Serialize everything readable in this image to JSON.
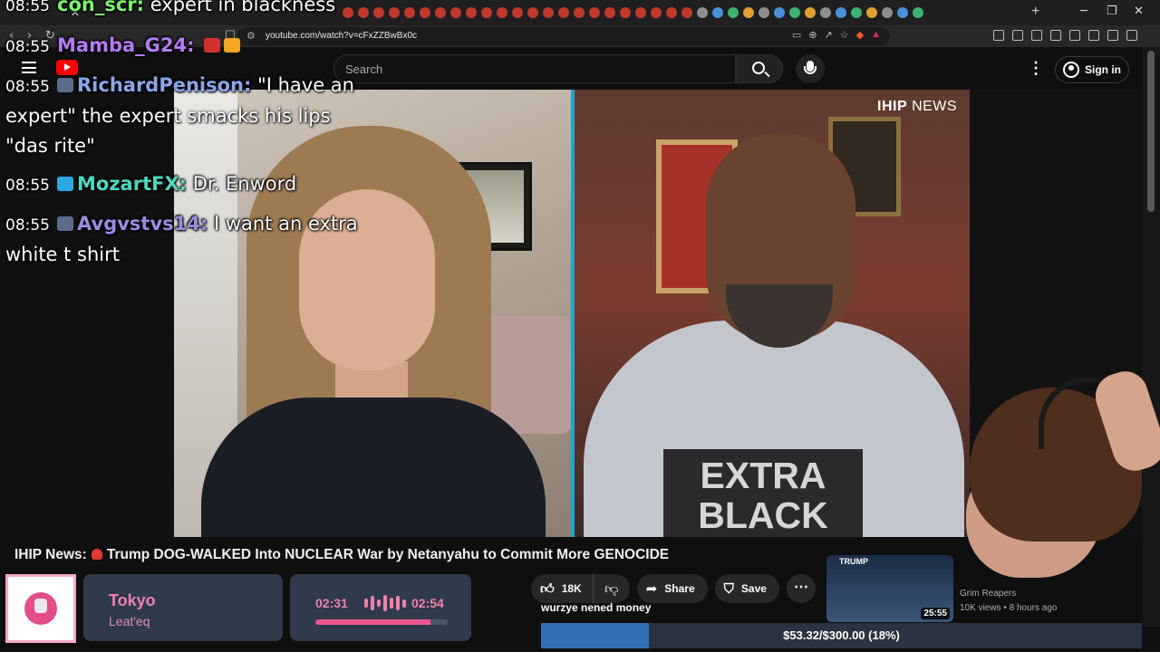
{
  "chat": {
    "messages": [
      {
        "time": "08:55",
        "user": "con_scr:",
        "text": "expert in blackness",
        "color": "#7cf26c"
      },
      {
        "time": "08:55",
        "user": "Mamba_G24:",
        "text": "",
        "color": "#b37cf2"
      },
      {
        "time": "08:55",
        "user": "RichardPenison:",
        "text": "\"I have an",
        "color": "#8aa6e8"
      },
      {
        "time": "08:55",
        "user": "MozartFX:",
        "text": "Dr. Enword",
        "color": "#4fd6c0"
      },
      {
        "time": "08:55",
        "user": "Avgvstvs14:",
        "text": "I want an extra",
        "color": "#9b8ce0"
      }
    ],
    "continuations": [
      "expert\" the expert smacks his lips",
      "\"das rite\"",
      "white t shirt"
    ]
  },
  "browser": {
    "url": "youtube.com/watch?v=cFxZZBwBx0c"
  },
  "youtube": {
    "search_placeholder": "Search",
    "sign_in_label": "Sign in"
  },
  "player": {
    "channel_bug_bold": "IHIP",
    "channel_bug_rest": "NEWS",
    "shirt_line1": "EXTRA",
    "shirt_line2": "BLACK"
  },
  "video": {
    "title_prefix": "IHIP News:",
    "title_text": "Trump DOG-WALKED Into NUCLEAR War by Netanyahu to Commit More GENOCIDE",
    "likes": "18K",
    "share_label": "Share",
    "save_label": "Save"
  },
  "recommendation": {
    "thumb_label": "TRUMP",
    "duration": "25:55",
    "channel": "Grim Reapers",
    "views_age": "10K views • 8 hours ago"
  },
  "music": {
    "title": "Tokyo",
    "artist": "Leat'eq",
    "current_time": "02:31",
    "total_time": "02:54",
    "progress": 0.87
  },
  "chat_notice": "wurzye nened money",
  "donation_goal": {
    "text": "$53.32/$300.00 (18%)",
    "fraction": 0.18
  }
}
